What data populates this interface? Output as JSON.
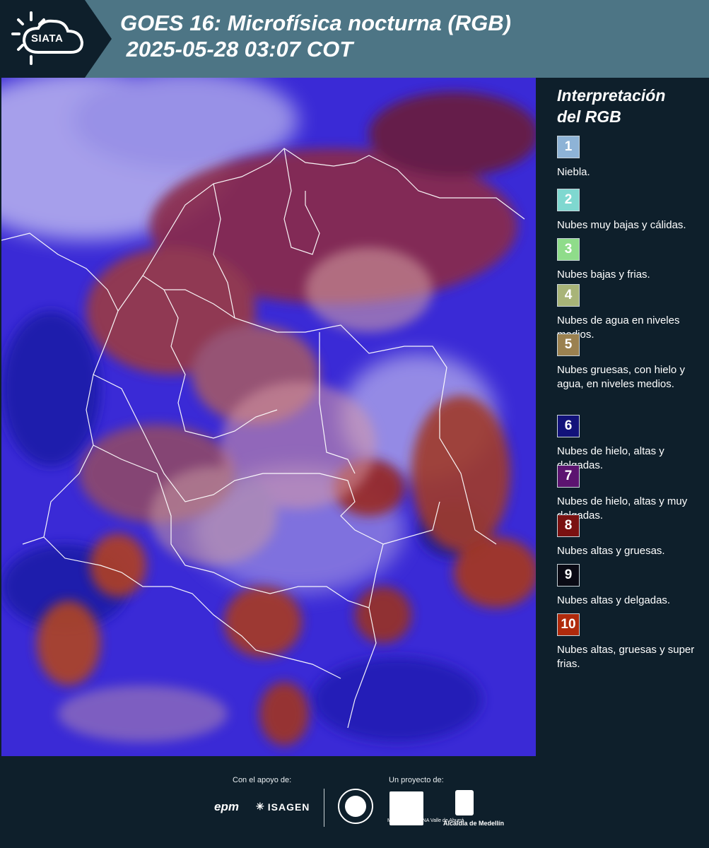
{
  "header": {
    "logo_text": "SIATA",
    "title_line1": "GOES 16: Microfísica nocturna (RGB)",
    "title_line2": " 2025-05-28 03:07 COT"
  },
  "legend": {
    "title_line1": "Interpretación",
    "title_line2": "del RGB",
    "items": [
      {
        "num": "1",
        "label": "Niebla.",
        "color": "#8eb3d6"
      },
      {
        "num": "2",
        "label": "Nubes muy bajas y cálidas.",
        "color": "#7fd8d0"
      },
      {
        "num": "3",
        "label": "Nubes bajas y frias.",
        "color": "#8fdc8a"
      },
      {
        "num": "4",
        "label": "Nubes de agua en niveles medios.",
        "color": "#a8b478"
      },
      {
        "num": "5",
        "label": "Nubes gruesas, con hielo y agua, en niveles medios.",
        "color": "#9b8150"
      },
      {
        "num": "6",
        "label": "Nubes de hielo, altas y delgadas.",
        "color": "#12127a"
      },
      {
        "num": "7",
        "label": "Nubes de hielo, altas y muy delgadas.",
        "color": "#5c1470"
      },
      {
        "num": "8",
        "label": "Nubes altas y gruesas.",
        "color": "#7a1111"
      },
      {
        "num": "9",
        "label": "Nubes altas y delgadas.",
        "color": "#0a0a14"
      },
      {
        "num": "10",
        "label": "Nubes altas, gruesas y super frias.",
        "color": "#b02a0c"
      }
    ]
  },
  "footer": {
    "support_label": "Con el apoyo de:",
    "project_label": "Un proyecto de:",
    "epm": "epm",
    "isagen": "ISAGEN",
    "amva": "METROPOLITANA Valle de Aburrá",
    "alcaldia": "Alcaldía de Medellín"
  }
}
